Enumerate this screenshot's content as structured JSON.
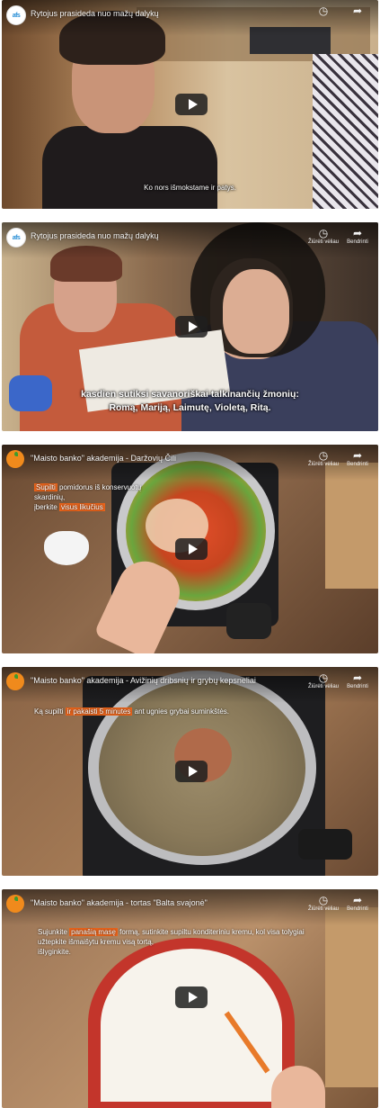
{
  "videos": [
    {
      "title": "Rytojus prasideda nuo mažų dalykų",
      "channel": "afs",
      "subtitle": "Ko nors išmokstame ir patys."
    },
    {
      "title": "Rytojus prasideda nuo mažų dalykų",
      "channel": "afs",
      "watch_later": "Žiūrėti vėliau",
      "share": "Bendrinti",
      "subtitle_line1": "kasdien sutiksi savanoriškai talkinančių žmonių:",
      "subtitle_line2": "Romą, Mariją, Laimutę, Violetą, Ritą."
    },
    {
      "title": "\"Maisto banko\" akademija - Daržovių Čili",
      "watch_later": "Žiūrėti vėliau",
      "share": "Bendrinti",
      "text_hl1": "Supilti",
      "text_part1": " pomidorus iš konservuotų skardinių,",
      "text_part2": "įberkite ",
      "text_hl2": "visus likučius"
    },
    {
      "title": "\"Maisto banko\" akademija - Avižinių dribsnių ir grybų kepsneliai",
      "watch_later": "Žiūrėti vėliau",
      "share": "Bendrinti",
      "text_part1": "Ką supilti ",
      "text_hl1": "ir pakaisti 5 minutes",
      "text_part2": " ant ugnies grybai suminkštės."
    },
    {
      "title": "\"Maisto banko\" akademija - tortas \"Balta svajonė\"",
      "watch_later": "Žiūrėti vėliau",
      "share": "Bendrinti",
      "text_part1": "Sujunkite ",
      "text_hl1": "panašią masę",
      "text_part2": " formą, sutinkite supiltu konditeriniu kremu, kol visa tolygiai",
      "text_line2": "užtepkite išmaišytu kremu visą tortą,",
      "text_line3": "išlyginkite."
    }
  ],
  "icons": {
    "watch_later": "clock-icon",
    "share": "share-arrow-icon",
    "play": "play-icon"
  }
}
